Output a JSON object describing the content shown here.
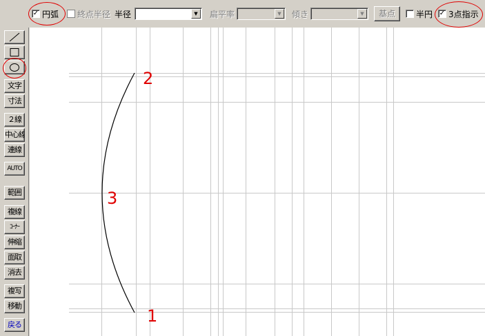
{
  "toolbar": {
    "arc": {
      "label": "円弧",
      "checked": true
    },
    "endpoint_radius": {
      "label": "終点半径",
      "checked": false
    },
    "radius": {
      "label": "半径",
      "value": ""
    },
    "flatness": {
      "label": "扁平率",
      "value": ""
    },
    "tilt": {
      "label": "傾き",
      "value": ""
    },
    "base_point_button": "基点",
    "semicircle": {
      "label": "半円",
      "checked": false
    },
    "three_point": {
      "label": "3点指示",
      "checked": true
    },
    "check_mark": "✓",
    "combo_arrow": "▼"
  },
  "palette": {
    "tools": [
      {
        "id": "line",
        "icon": "line-icon"
      },
      {
        "id": "rect",
        "icon": "rectangle-icon"
      },
      {
        "id": "circle",
        "icon": "circle-icon"
      },
      {
        "id": "text",
        "label": "文字"
      },
      {
        "id": "dimension",
        "label": "寸法"
      },
      {
        "id": "double-line",
        "label": "２線"
      },
      {
        "id": "center-line",
        "label": "中心線"
      },
      {
        "id": "continuous-line",
        "label": "連線"
      },
      {
        "id": "auto",
        "label": "AUTO"
      },
      {
        "id": "range",
        "label": "範囲"
      },
      {
        "id": "multi-line",
        "label": "複線"
      },
      {
        "id": "corner",
        "label": "ｺｰﾅｰ"
      },
      {
        "id": "stretch",
        "label": "伸縮"
      },
      {
        "id": "chamfer",
        "label": "面取"
      },
      {
        "id": "erase",
        "label": "消去"
      },
      {
        "id": "copy",
        "label": "複写"
      },
      {
        "id": "move",
        "label": "移動"
      },
      {
        "id": "back",
        "label": "戻る"
      }
    ]
  },
  "canvas": {
    "point_labels": {
      "p1": "1",
      "p2": "2",
      "p3": "3"
    },
    "colors": {
      "grid": "#c8c8c8",
      "arc": "#000000",
      "annotation": "#e00000"
    }
  }
}
